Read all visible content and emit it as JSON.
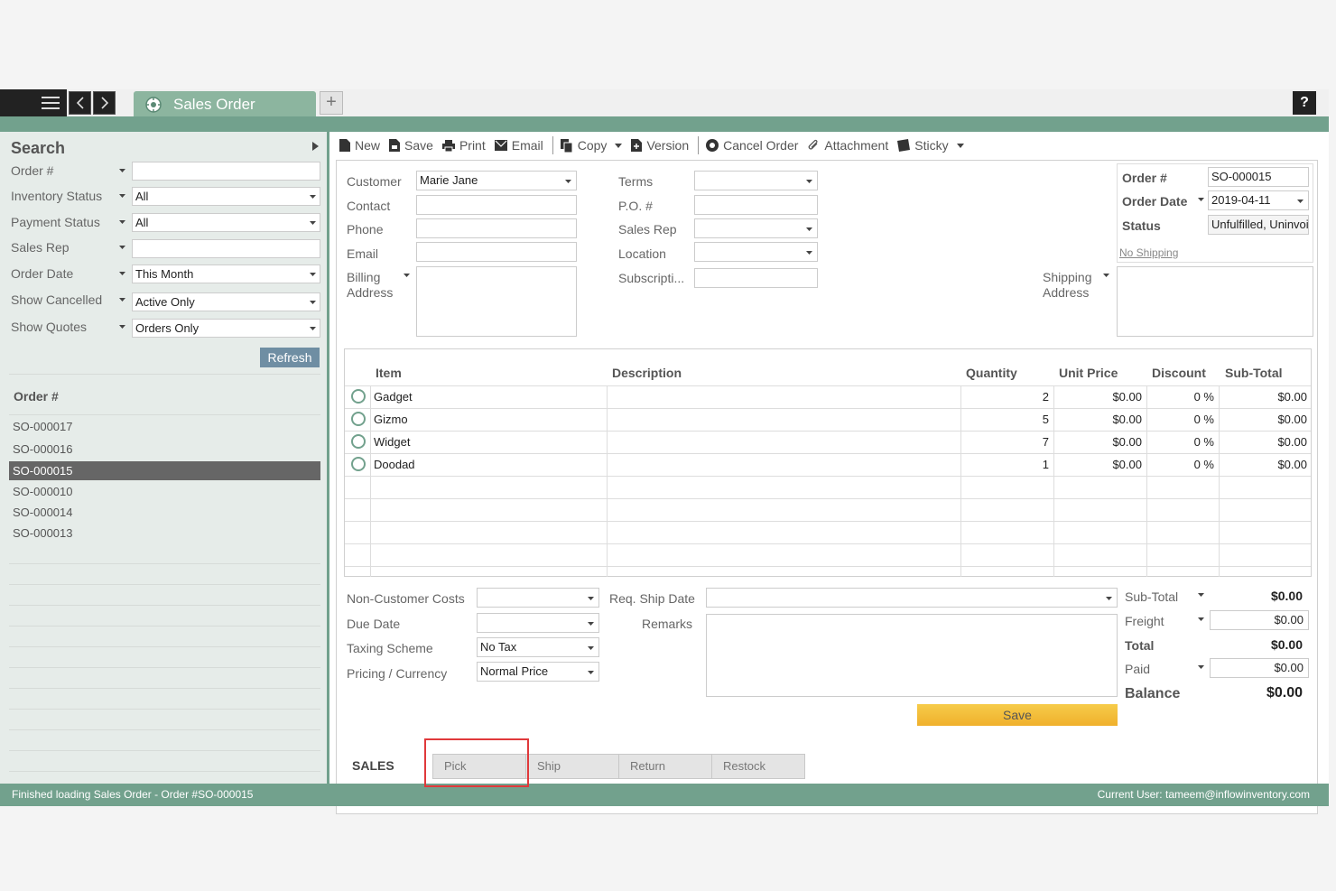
{
  "window": {
    "tab_title": "Sales Order",
    "help_label": "?"
  },
  "sidebar": {
    "title": "Search",
    "filters": [
      {
        "label": "Order #",
        "value": ""
      },
      {
        "label": "Inventory Status",
        "value": "All"
      },
      {
        "label": "Payment Status",
        "value": "All"
      },
      {
        "label": "Sales Rep",
        "value": ""
      },
      {
        "label": "Order Date",
        "value": "This Month"
      },
      {
        "label": "Show Cancelled",
        "value": "Active Only"
      },
      {
        "label": "Show Quotes",
        "value": "Orders Only"
      }
    ],
    "refresh_label": "Refresh",
    "list_header": "Order #",
    "orders": [
      "SO-000017",
      "SO-000016",
      "SO-000015",
      "SO-000010",
      "SO-000014",
      "SO-000013"
    ],
    "selected_order": "SO-000015"
  },
  "toolbar": {
    "new": "New",
    "save": "Save",
    "print": "Print",
    "email": "Email",
    "copy": "Copy",
    "version": "Version",
    "cancel_order": "Cancel Order",
    "attachment": "Attachment",
    "sticky": "Sticky"
  },
  "form": {
    "customer_label": "Customer",
    "customer_value": "Marie Jane",
    "contact_label": "Contact",
    "phone_label": "Phone",
    "email_label": "Email",
    "billing_label_1": "Billing",
    "billing_label_2": "Address",
    "terms_label": "Terms",
    "po_label": "P.O. #",
    "sales_rep_label": "Sales Rep",
    "location_label": "Location",
    "subscription_label": "Subscripti...",
    "order_no_label": "Order #",
    "order_no_value": "SO-000015",
    "order_date_label": "Order Date",
    "order_date_value": "2019-04-11",
    "status_label": "Status",
    "status_value": "Unfulfilled, Uninvoic",
    "no_shipping_link": "No Shipping",
    "shipping_label_1": "Shipping",
    "shipping_label_2": "Address"
  },
  "items_table": {
    "headers": {
      "item": "Item",
      "description": "Description",
      "quantity": "Quantity",
      "unit_price": "Unit Price",
      "discount": "Discount",
      "subtotal": "Sub-Total"
    },
    "rows": [
      {
        "item": "Gadget",
        "description": "",
        "quantity": "2",
        "unit_price": "$0.00",
        "discount": "0 %",
        "subtotal": "$0.00"
      },
      {
        "item": "Gizmo",
        "description": "",
        "quantity": "5",
        "unit_price": "$0.00",
        "discount": "0 %",
        "subtotal": "$0.00"
      },
      {
        "item": "Widget",
        "description": "",
        "quantity": "7",
        "unit_price": "$0.00",
        "discount": "0 %",
        "subtotal": "$0.00"
      },
      {
        "item": "Doodad",
        "description": "",
        "quantity": "1",
        "unit_price": "$0.00",
        "discount": "0 %",
        "subtotal": "$0.00"
      }
    ]
  },
  "bottom": {
    "non_customer_costs_label": "Non-Customer Costs",
    "due_date_label": "Due Date",
    "taxing_scheme_label": "Taxing Scheme",
    "taxing_scheme_value": "No Tax",
    "pricing_label": "Pricing / Currency",
    "pricing_value": "Normal Price",
    "req_ship_date_label": "Req. Ship Date",
    "remarks_label": "Remarks",
    "save_label": "Save"
  },
  "totals": {
    "subtotal_label": "Sub-Total",
    "subtotal_value": "$0.00",
    "freight_label": "Freight",
    "freight_value": "$0.00",
    "total_label": "Total",
    "total_value": "$0.00",
    "paid_label": "Paid",
    "paid_value": "$0.00",
    "balance_label": "Balance",
    "balance_value": "$0.00"
  },
  "subtabs": {
    "sales": "SALES",
    "pick": "Pick",
    "ship": "Ship",
    "return": "Return",
    "restock": "Restock"
  },
  "status_bar": {
    "message": "Finished loading Sales Order - Order #SO-000015",
    "user_label": "Current User:",
    "user_email": "tameem@inflowinventory.com"
  },
  "colors": {
    "accent_green": "#72a18d",
    "tab_green": "#8cb59f",
    "refresh_blue": "#6f8ea3",
    "save_yellow": "#f0b02c",
    "highlight_red": "#e0393b"
  }
}
